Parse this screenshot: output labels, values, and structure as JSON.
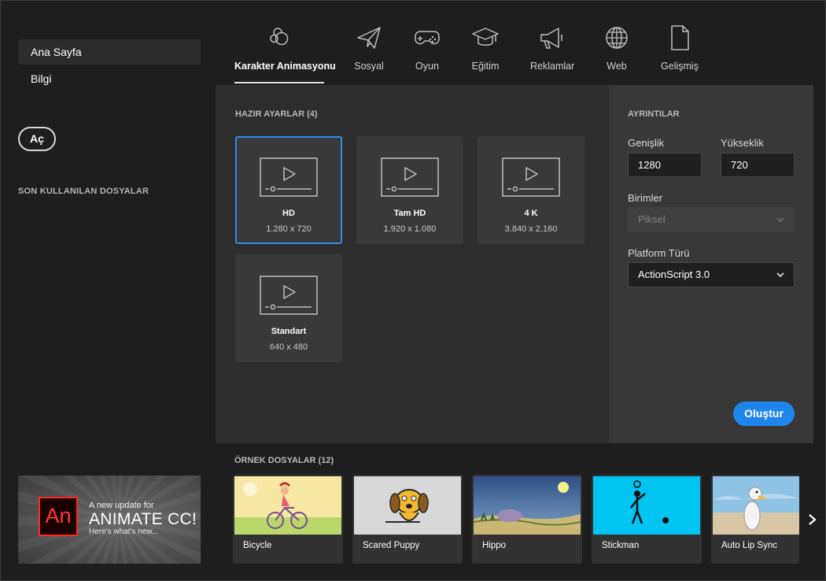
{
  "sidebar": {
    "items": [
      {
        "label": "Ana Sayfa",
        "active": true
      },
      {
        "label": "Bilgi",
        "active": false
      }
    ],
    "open_label": "Aç",
    "recent_title": "SON KULLANILAN DOSYALAR"
  },
  "promo": {
    "logo_text": "An",
    "line1": "A new update for",
    "line2": "ANIMATE CC!",
    "line3": "Here's what's new..."
  },
  "tabs": [
    {
      "label": "Karakter Animasyonu",
      "icon": "character-animation-icon",
      "active": true
    },
    {
      "label": "Sosyal",
      "icon": "paper-plane-icon",
      "active": false
    },
    {
      "label": "Oyun",
      "icon": "gamepad-icon",
      "active": false
    },
    {
      "label": "Eğitim",
      "icon": "graduation-cap-icon",
      "active": false
    },
    {
      "label": "Reklamlar",
      "icon": "megaphone-icon",
      "active": false
    },
    {
      "label": "Web",
      "icon": "globe-icon",
      "active": false
    },
    {
      "label": "Gelişmiş",
      "icon": "document-icon",
      "active": false
    }
  ],
  "presets": {
    "title": "HAZIR AYARLAR (4)",
    "items": [
      {
        "name": "HD",
        "size": "1.280 x 720",
        "selected": true
      },
      {
        "name": "Tam HD",
        "size": "1.920 x 1.080",
        "selected": false
      },
      {
        "name": "4 K",
        "size": "3.840 x 2.160",
        "selected": false
      },
      {
        "name": "Standart",
        "size": "640 x 480",
        "selected": false
      }
    ]
  },
  "details": {
    "title": "AYRINTILAR",
    "width_label": "Genişlik",
    "width_value": "1280",
    "height_label": "Yükseklik",
    "height_value": "720",
    "units_label": "Birimler",
    "units_value": "Piksel",
    "platform_label": "Platform Türü",
    "platform_value": "ActionScript 3.0",
    "create_label": "Oluştur"
  },
  "samples": {
    "title": "ÖRNEK DOSYALAR (12)",
    "items": [
      {
        "label": "Bicycle"
      },
      {
        "label": "Scared Puppy"
      },
      {
        "label": "Hippo"
      },
      {
        "label": "Stickman"
      },
      {
        "label": "Auto Lip Sync"
      }
    ]
  },
  "colors": {
    "accent": "#1e85ea",
    "background": "#1e1e1e",
    "panel": "#2d2d2d",
    "details_panel": "#383838",
    "brand_red": "#ff2a1f"
  }
}
